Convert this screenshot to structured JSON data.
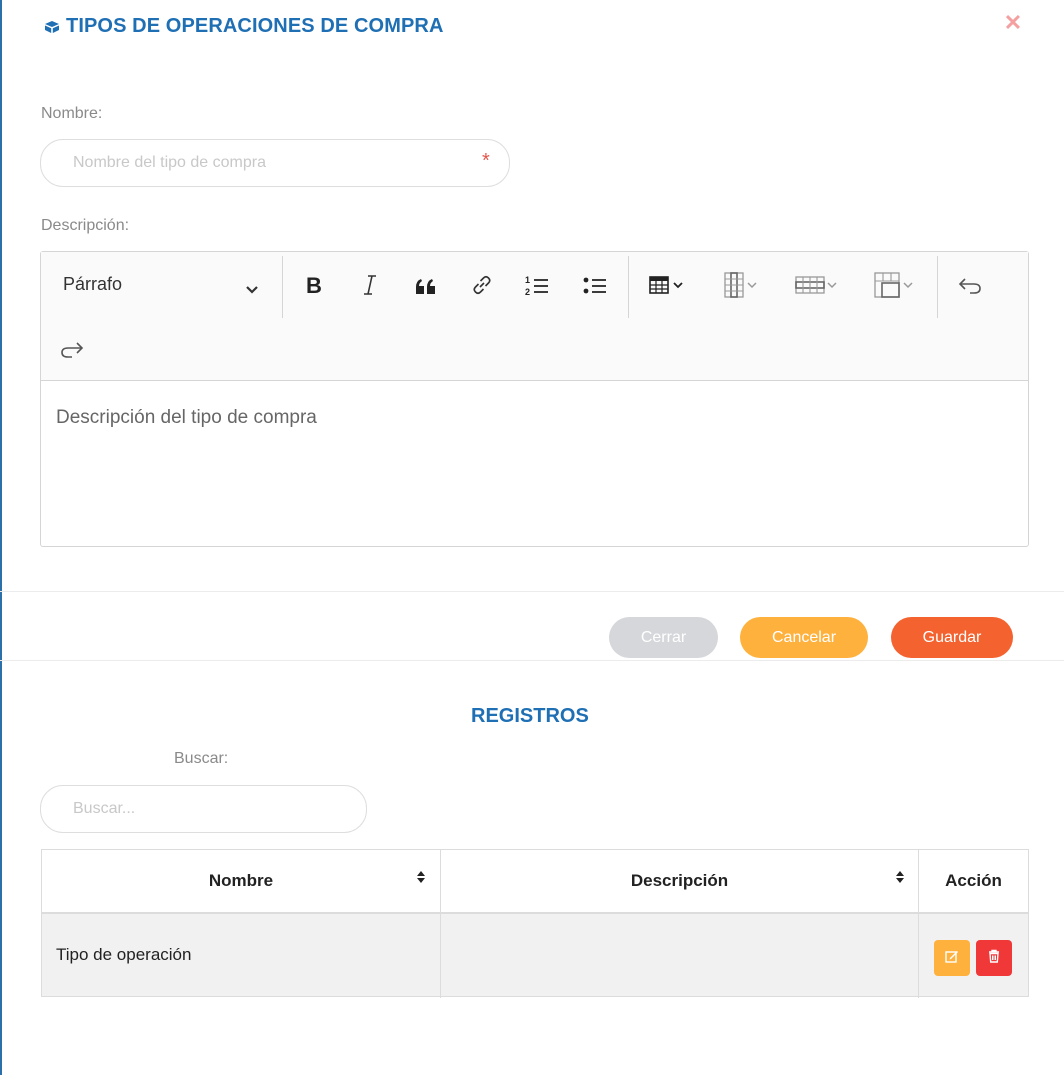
{
  "modal": {
    "title": "TIPOS DE OPERACIONES DE COMPRA",
    "title_icon": "boxes-icon",
    "close_icon": "close-icon",
    "close_glyph": "✕"
  },
  "form": {
    "name_label": "Nombre:",
    "name_placeholder": "Nombre del tipo de compra",
    "name_value": "",
    "required_mark": "*",
    "description_label": "Descripción:",
    "editor": {
      "paragraph_format": "Párrafo",
      "toolbar_icons": [
        "bold-icon",
        "italic-icon",
        "blockquote-icon",
        "link-icon",
        "numbered-list-icon",
        "bulleted-list-icon",
        "insert-table-icon",
        "table-column-icon",
        "table-row-icon",
        "merge-cells-icon",
        "undo-icon",
        "redo-icon"
      ],
      "body_placeholder": "Descripción del tipo de compra"
    }
  },
  "actions": {
    "close_label": "Cerrar",
    "cancel_label": "Cancelar",
    "save_label": "Guardar"
  },
  "registros": {
    "title": "REGISTROS",
    "search_label": "Buscar:",
    "search_placeholder": "Buscar...",
    "columns": [
      "Nombre",
      "Descripción",
      "Acción"
    ],
    "rows": [
      {
        "nombre": "Tipo de operación",
        "descripcion": ""
      }
    ]
  },
  "colors": {
    "accent": "#1e6fb4",
    "close": "#f4a0a0",
    "cancel": "#ffb13d",
    "save": "#f4622f",
    "delete": "#f03838",
    "disabled": "#d5d7da"
  }
}
